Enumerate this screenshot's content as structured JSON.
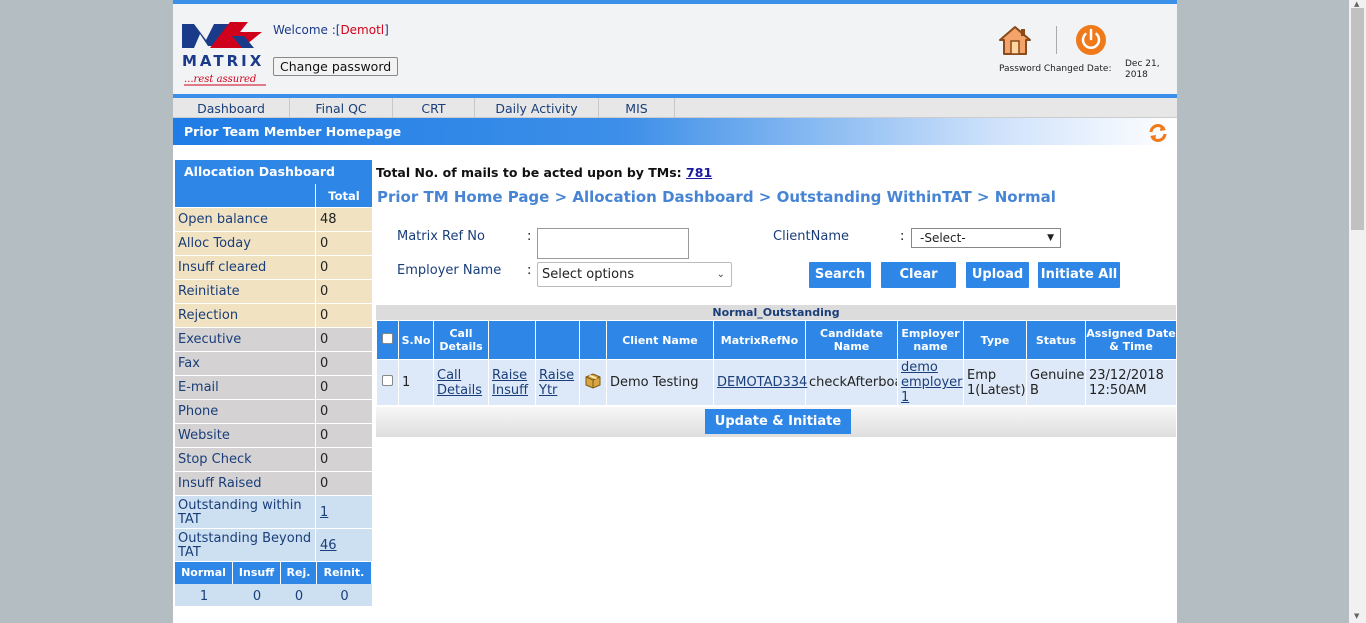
{
  "header": {
    "logo_text": "MATRIX",
    "logo_tagline": "...rest assured",
    "welcome_prefix": "Welcome :[",
    "username": "Demotl",
    "welcome_suffix": "]",
    "change_password": "Change password",
    "password_changed_label": "Password Changed Date:",
    "password_changed_date": "Dec 21, 2018"
  },
  "nav": [
    {
      "label": "Dashboard"
    },
    {
      "label": "Final QC"
    },
    {
      "label": "CRT"
    },
    {
      "label": "Daily Activity"
    },
    {
      "label": "MIS"
    }
  ],
  "banner": {
    "title": "Prior Team Member Homepage"
  },
  "allocation": {
    "title": "Allocation Dashboard",
    "total_header": "Total",
    "rows": [
      {
        "label": "Open balance",
        "value": "48"
      },
      {
        "label": "Alloc Today",
        "value": "0"
      },
      {
        "label": "Insuff cleared",
        "value": "0"
      },
      {
        "label": "Reinitiate",
        "value": "0"
      },
      {
        "label": "Rejection",
        "value": "0"
      },
      {
        "label": "Executive",
        "value": "0"
      },
      {
        "label": "Fax",
        "value": "0"
      },
      {
        "label": "E-mail",
        "value": "0"
      },
      {
        "label": "Phone",
        "value": "0"
      },
      {
        "label": "Website",
        "value": "0"
      },
      {
        "label": "Stop Check",
        "value": "0"
      },
      {
        "label": "Insuff Raised",
        "value": "0"
      },
      {
        "label": "Outstanding within TAT",
        "value": "1"
      },
      {
        "label": "Outstanding Beyond TAT",
        "value": "46"
      }
    ],
    "summary_headers": [
      "Normal",
      "Insuff",
      "Rej.",
      "Reinit."
    ],
    "summary_values": [
      "1",
      "0",
      "0",
      "0"
    ]
  },
  "main": {
    "mails_label": "Total No. of mails to be acted upon by TMs:",
    "mails_count": "781",
    "breadcrumb": "Prior TM Home Page > Allocation Dashboard > Outstanding WithinTAT > Normal",
    "form": {
      "matrix_ref_label": "Matrix Ref No",
      "client_label": "ClientName",
      "client_selected": "-Select-",
      "employer_label": "Employer Name",
      "employer_placeholder": "Select options",
      "colon": ":"
    },
    "buttons": {
      "search": "Search",
      "clear": "Clear",
      "upload": "Upload",
      "initiate_all": "Initiate All"
    },
    "grid": {
      "title": "Normal_Outstanding",
      "headers": {
        "sno": "S.No",
        "call": "Call Details",
        "client": "Client Name",
        "ref": "MatrixRefNo",
        "candidate": "Candidate Name",
        "employer": "Employer name",
        "type": "Type",
        "status": "Status",
        "assigned": "Assigned Date & Time"
      },
      "row": {
        "sno": "1",
        "call_details": "Call Details",
        "raise_insuff": "Raise Insuff",
        "raise_ytr": "Raise Ytr",
        "client": "Demo Testing",
        "ref": "DEMOTAD334",
        "candidate": "checkAfterboa",
        "employer": "demo employer 1",
        "type": "Emp 1(Latest)",
        "status": "Genuine B",
        "assigned": "23/12/2018 12:50AM"
      },
      "update_button": "Update & Initiate VR"
    }
  },
  "colors": {
    "accent": "#2e86e6",
    "tan": "#f1e2c2",
    "grey": "#d4d2d2",
    "light_blue": "#cde0f2",
    "username_red": "#d0021b"
  },
  "icons": [
    "home-icon",
    "power-icon",
    "refresh-icon",
    "package-icon",
    "checkbox-icon"
  ]
}
